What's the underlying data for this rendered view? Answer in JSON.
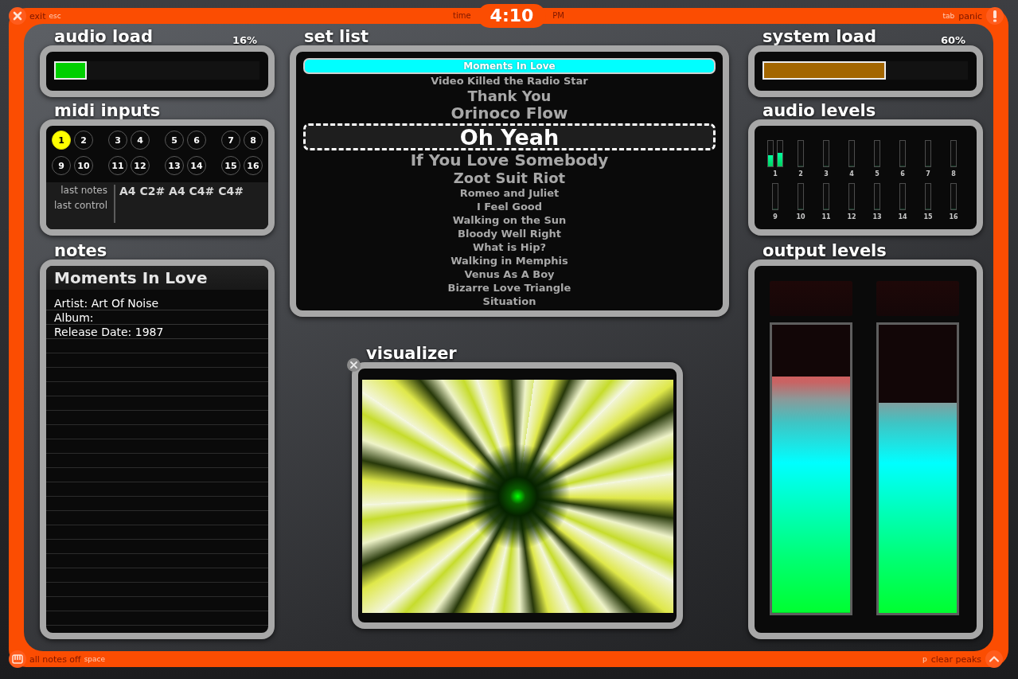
{
  "top_bar": {
    "exit": {
      "action": "exit",
      "key": "esc"
    },
    "clock": {
      "label": "time",
      "time": "4:10",
      "period": "PM"
    },
    "panic": {
      "key": "tab",
      "action": "panic"
    }
  },
  "audio_load": {
    "title": "audio load",
    "reading": "16%",
    "level": 0.16
  },
  "midi_inputs": {
    "title": "midi inputs",
    "channels": [
      {
        "label": "1",
        "active": true
      },
      {
        "label": "2",
        "active": false
      },
      {
        "label": "3",
        "active": false
      },
      {
        "label": "4",
        "active": false
      },
      {
        "label": "5",
        "active": false
      },
      {
        "label": "6",
        "active": false
      },
      {
        "label": "7",
        "active": false
      },
      {
        "label": "8",
        "active": false
      },
      {
        "label": "9",
        "active": false
      },
      {
        "label": "10",
        "active": false
      },
      {
        "label": "11",
        "active": false
      },
      {
        "label": "12",
        "active": false
      },
      {
        "label": "13",
        "active": false
      },
      {
        "label": "14",
        "active": false
      },
      {
        "label": "15",
        "active": false
      },
      {
        "label": "16",
        "active": false
      }
    ],
    "last_notes_label": "last notes",
    "last_control_label": "last control",
    "last_notes": "A4 C2# A4 C4# C4#"
  },
  "notes": {
    "title": "notes",
    "song": "Moments In Love",
    "lines": [
      "Artist: Art Of Noise",
      "Album:",
      "Release Date: 1987"
    ]
  },
  "set_list": {
    "title": "set list",
    "songs": [
      {
        "title": "Moments In Love",
        "selected": true,
        "cued": false
      },
      {
        "title": "Video Killed the Radio Star",
        "selected": false,
        "cued": false
      },
      {
        "title": "Thank You",
        "selected": false,
        "cued": false
      },
      {
        "title": "Orinoco Flow",
        "selected": false,
        "cued": false
      },
      {
        "title": "Oh Yeah",
        "selected": false,
        "cued": true
      },
      {
        "title": "If You Love Somebody",
        "selected": false,
        "cued": false
      },
      {
        "title": "Zoot Suit Riot",
        "selected": false,
        "cued": false
      },
      {
        "title": "Romeo and Juliet",
        "selected": false,
        "cued": false
      },
      {
        "title": "I Feel Good",
        "selected": false,
        "cued": false
      },
      {
        "title": "Walking on the Sun",
        "selected": false,
        "cued": false
      },
      {
        "title": "Bloody Well Right",
        "selected": false,
        "cued": false
      },
      {
        "title": "What is Hip?",
        "selected": false,
        "cued": false
      },
      {
        "title": "Walking in Memphis",
        "selected": false,
        "cued": false
      },
      {
        "title": "Venus As A Boy",
        "selected": false,
        "cued": false
      },
      {
        "title": "Bizarre Love Triangle",
        "selected": false,
        "cued": false
      },
      {
        "title": "Situation",
        "selected": false,
        "cued": false
      }
    ]
  },
  "visualizer": {
    "title": "visualizer"
  },
  "system_load": {
    "title": "system load",
    "reading": "60%",
    "level": 0.6
  },
  "audio_levels": {
    "title": "audio levels",
    "channels": [
      {
        "label": "1",
        "meters": [
          {
            "level": 0.45
          },
          {
            "level": 0.52
          }
        ]
      },
      {
        "label": "2",
        "meters": [
          {
            "level": 0
          }
        ]
      },
      {
        "label": "3",
        "meters": [
          {
            "level": 0
          }
        ]
      },
      {
        "label": "4",
        "meters": [
          {
            "level": 0
          }
        ]
      },
      {
        "label": "5",
        "meters": [
          {
            "level": 0
          }
        ]
      },
      {
        "label": "6",
        "meters": [
          {
            "level": 0
          }
        ]
      },
      {
        "label": "7",
        "meters": [
          {
            "level": 0
          }
        ]
      },
      {
        "label": "8",
        "meters": [
          {
            "level": 0
          }
        ]
      },
      {
        "label": "9",
        "meters": [
          {
            "level": 0
          }
        ]
      },
      {
        "label": "10",
        "meters": [
          {
            "level": 0
          }
        ]
      },
      {
        "label": "11",
        "meters": [
          {
            "level": 0
          }
        ]
      },
      {
        "label": "12",
        "meters": [
          {
            "level": 0
          }
        ]
      },
      {
        "label": "13",
        "meters": [
          {
            "level": 0
          }
        ]
      },
      {
        "label": "14",
        "meters": [
          {
            "level": 0
          }
        ]
      },
      {
        "label": "15",
        "meters": [
          {
            "level": 0
          }
        ]
      },
      {
        "label": "16",
        "meters": [
          {
            "level": 0
          }
        ]
      }
    ]
  },
  "output_levels": {
    "title": "output levels",
    "channels": [
      {
        "clipped": false,
        "level": 0.82
      },
      {
        "clipped": false,
        "level": 0.73
      }
    ]
  },
  "bottom_bar": {
    "notes_off": {
      "action": "all notes off",
      "key": "space"
    },
    "clear_peaks": {
      "key": "p",
      "action": "clear peaks"
    }
  }
}
